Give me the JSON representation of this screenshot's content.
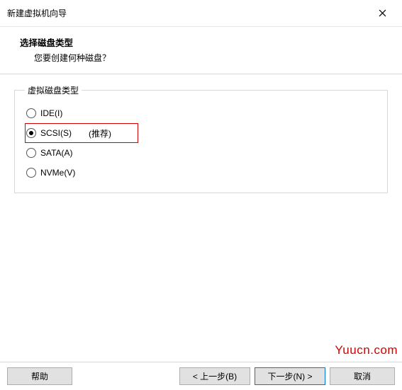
{
  "window": {
    "title": "新建虚拟机向导"
  },
  "header": {
    "title": "选择磁盘类型",
    "subtitle": "您要创建何种磁盘？"
  },
  "group": {
    "legend": "虚拟磁盘类型",
    "options": {
      "ide": {
        "label": "IDE(I)"
      },
      "scsi": {
        "label": "SCSI(S)",
        "recommended": "(推荐)"
      },
      "sata": {
        "label": "SATA(A)"
      },
      "nvme": {
        "label": "NVMe(V)"
      }
    },
    "selected": "scsi"
  },
  "footer": {
    "help": "帮助",
    "back": "< 上一步(B)",
    "next": "下一步(N) >",
    "cancel": "取消"
  },
  "watermark": "Yuucn.com"
}
